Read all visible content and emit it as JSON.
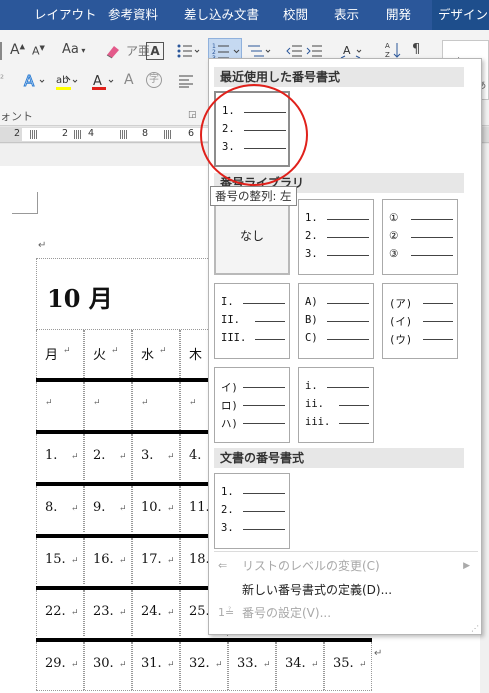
{
  "ribbon_tabs": [
    "レイアウト",
    "参考資料",
    "差し込み文書",
    "校閲",
    "表示",
    "開発",
    "デザイン"
  ],
  "ribbon": {
    "font_grow": "A",
    "font_shrink": "A",
    "change_case": "Aa",
    "group_label": "ォント",
    "style_preview": "あア亜"
  },
  "ruler": {
    "ticks": [
      "2",
      "2",
      "4",
      "8",
      "6"
    ]
  },
  "document": {
    "calendar_title": "10 月",
    "weekdays": [
      "月",
      "火",
      "水",
      "木"
    ],
    "rows": [
      [
        "1.",
        "2.",
        "3.",
        "4."
      ],
      [
        "8.",
        "9.",
        "10.",
        "11."
      ],
      [
        "15.",
        "16.",
        "17.",
        "18."
      ],
      [
        "22.",
        "23.",
        "24.",
        "25."
      ],
      [
        "29.",
        "30.",
        "31.",
        "32.",
        "33.",
        "34.",
        "35."
      ]
    ]
  },
  "dropdown": {
    "recent_header": "最近使用した番号書式",
    "library_header": "番号ライブラリ",
    "document_header": "文書の番号書式",
    "tooltip": "番号の整列: 左",
    "none_label": "なし",
    "recent_formats": [
      [
        "1.",
        "2.",
        "3."
      ]
    ],
    "library_formats": [
      [
        "1.",
        "2.",
        "3."
      ],
      [
        "①",
        "②",
        "③"
      ],
      [
        "I.",
        "II.",
        "III."
      ],
      [
        "A)",
        "B)",
        "C)"
      ],
      [
        "(ア)",
        "(イ)",
        "(ウ)"
      ],
      [
        "イ)",
        "ロ)",
        "ハ)"
      ],
      [
        "i.",
        "ii.",
        "iii."
      ]
    ],
    "document_formats": [
      [
        "1.",
        "2.",
        "3."
      ]
    ],
    "menu": {
      "change_level": "リストのレベルの変更(C)",
      "define_new": "新しい番号書式の定義(D)...",
      "set_value": "番号の設定(V)..."
    }
  },
  "colors": {
    "tab_bar": "#2b579a",
    "highlight": "#e0211b"
  }
}
